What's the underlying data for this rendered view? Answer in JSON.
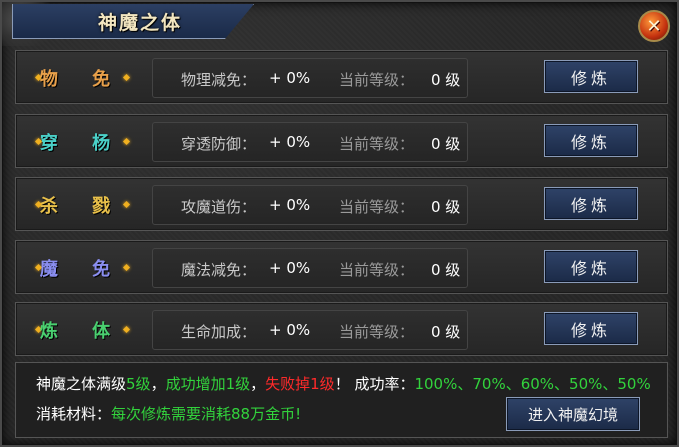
{
  "window": {
    "title": "神魔之体",
    "close_icon": "close-x-icon"
  },
  "rows": [
    {
      "name": "物 免",
      "name_color": "#e8a04a",
      "stat_label": "物理减免：",
      "stat_value": "+ 0%",
      "level_label": "当前等级：",
      "level_value": "0 级",
      "button_label": "修炼"
    },
    {
      "name": "穿 杨",
      "name_color": "#4ad0c8",
      "stat_label": "穿透防御：",
      "stat_value": "+ 0%",
      "level_label": "当前等级：",
      "level_value": "0 级",
      "button_label": "修炼"
    },
    {
      "name": "杀 戮",
      "name_color": "#e8c04a",
      "stat_label": "攻魔道伤：",
      "stat_value": "+ 0%",
      "level_label": "当前等级：",
      "level_value": "0 级",
      "button_label": "修炼"
    },
    {
      "name": "魔 免",
      "name_color": "#8a8ef0",
      "stat_label": "魔法减免：",
      "stat_value": "+ 0%",
      "level_label": "当前等级：",
      "level_value": "0 级",
      "button_label": "修炼"
    },
    {
      "name": "炼 体",
      "name_color": "#4ad070",
      "stat_label": "生命加成：",
      "stat_value": "+ 0%",
      "level_label": "当前等级：",
      "level_value": "0 级",
      "button_label": "修炼"
    }
  ],
  "info": {
    "line1": {
      "p1": "神魔之体满级",
      "p2": "5级",
      "p3": "，",
      "p4": "成功增加1级",
      "p5": "，",
      "p6": "失败掉1级",
      "p7": "！ 成功率：",
      "p8": "100%、70%、60%、50%、50%"
    },
    "line2": {
      "label": "消耗材料：",
      "value": "每次修炼需要消耗88万金币!"
    },
    "enter_button": "进入神魔幻境"
  },
  "colors": {
    "highlight_green": "#32d23c",
    "highlight_red": "#ff2a2a",
    "button_blue": "#2f4368"
  }
}
